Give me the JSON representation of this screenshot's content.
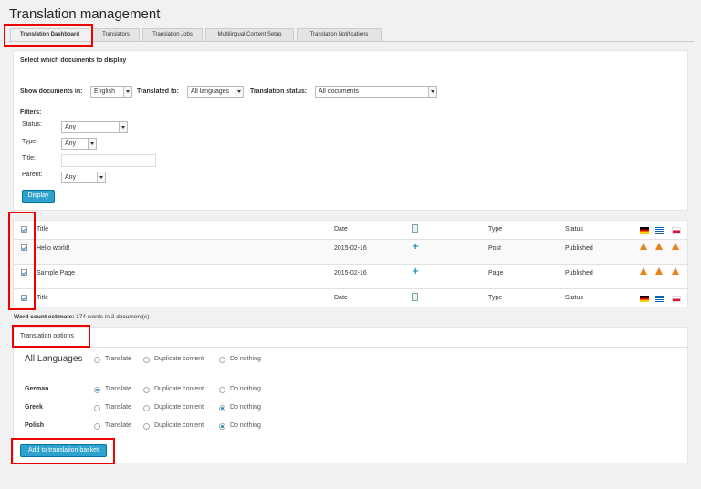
{
  "title": "Translation management",
  "tabs": [
    {
      "label": "Translation Dashboard"
    },
    {
      "label": "Translators"
    },
    {
      "label": "Translation Jobs"
    },
    {
      "label": "Multilingual Content Setup"
    },
    {
      "label": "Translation Notifications"
    }
  ],
  "filter_panel": {
    "heading": "Select which documents to display",
    "show_documents_label": "Show documents in:",
    "show_documents_value": "English",
    "translated_to_label": "Translated to:",
    "translated_to_value": "All languages",
    "status_label": "Translation status:",
    "status_value": "All documents",
    "filters_label": "Filters:",
    "status_filter_label": "Status:",
    "status_filter_value": "Any",
    "type_label": "Type:",
    "type_value": "Any",
    "title_label": "Title:",
    "title_value": "",
    "parent_label": "Parent:",
    "parent_value": "Any",
    "display_button": "Display"
  },
  "table": {
    "headers": {
      "title": "Title",
      "date": "Date",
      "type": "Type",
      "status": "Status"
    },
    "rows": [
      {
        "title": "Hello world!",
        "date": "2015-02-16",
        "type": "Post",
        "status": "Published"
      },
      {
        "title": "Sample Page",
        "date": "2015-02-16",
        "type": "Page",
        "status": "Published"
      }
    ],
    "flags": [
      "german-flag",
      "greek-flag",
      "polish-flag"
    ]
  },
  "word_count": {
    "label": "Word count estimate:",
    "value": "174 words in 2 document(s)"
  },
  "translation_options": {
    "heading": "Translation options",
    "all_languages": "All Languages",
    "opt_translate": "Translate",
    "opt_duplicate": "Duplicate content",
    "opt_nothing": "Do nothing",
    "languages": [
      {
        "name": "German",
        "selected": "translate"
      },
      {
        "name": "Greek",
        "selected": "nothing"
      },
      {
        "name": "Polish",
        "selected": "nothing"
      }
    ],
    "add_button": "Add to translation basket"
  },
  "colors": {
    "accent": "#2ea2cc",
    "link": "#0073aa",
    "highlight": "#e00000",
    "warning": "#e8821a"
  }
}
